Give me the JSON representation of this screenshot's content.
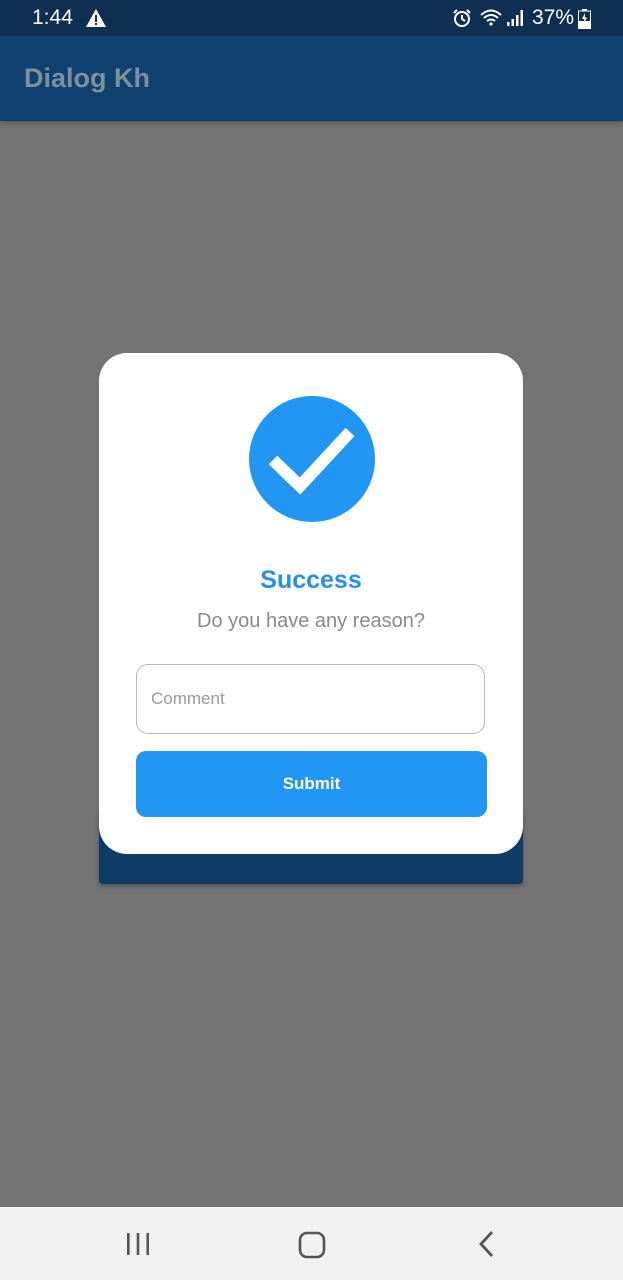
{
  "status_bar": {
    "time": "1:44",
    "battery": "37%",
    "icons": [
      "warning-icon",
      "alarm-icon",
      "wifi-icon",
      "signal-icon",
      "battery-icon"
    ]
  },
  "app_bar": {
    "title": "Dialog Kh"
  },
  "dialog": {
    "icon": "check-circle-icon",
    "title": "Success",
    "message": "Do you have any reason?",
    "comment_placeholder": "Comment",
    "comment_value": "",
    "submit_label": "Submit"
  },
  "nav_bar": {
    "icons": [
      "recents-icon",
      "home-icon",
      "back-icon"
    ]
  },
  "colors": {
    "accent": "#2196f3",
    "title": "#2591e3",
    "app_bar": "#10426f",
    "status_bar": "#0e2f52",
    "scrim": "#737373"
  }
}
